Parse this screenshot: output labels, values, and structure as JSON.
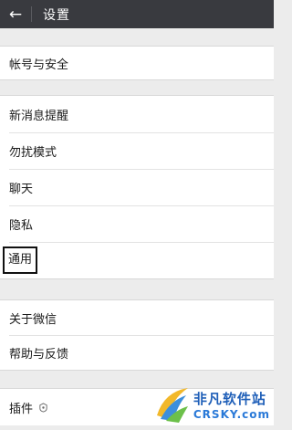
{
  "header": {
    "back_icon": "arrow-left-icon",
    "title": "设置"
  },
  "groups": [
    {
      "items": [
        {
          "label": "帐号与安全"
        }
      ]
    },
    {
      "items": [
        {
          "label": "新消息提醒"
        },
        {
          "label": "勿扰模式"
        },
        {
          "label": "聊天"
        },
        {
          "label": "隐私"
        },
        {
          "label": "通用",
          "highlighted": true
        }
      ]
    },
    {
      "items": [
        {
          "label": "关于微信"
        },
        {
          "label": "帮助与反馈"
        }
      ]
    },
    {
      "items": [
        {
          "label": "插件",
          "icon": "plugin-icon"
        }
      ]
    }
  ],
  "watermark": {
    "cn": "非凡软件站",
    "en": "CRSKY.com"
  },
  "colors": {
    "topbar": "#393a3f",
    "background": "#ececec",
    "highlight_border": "#111111"
  }
}
